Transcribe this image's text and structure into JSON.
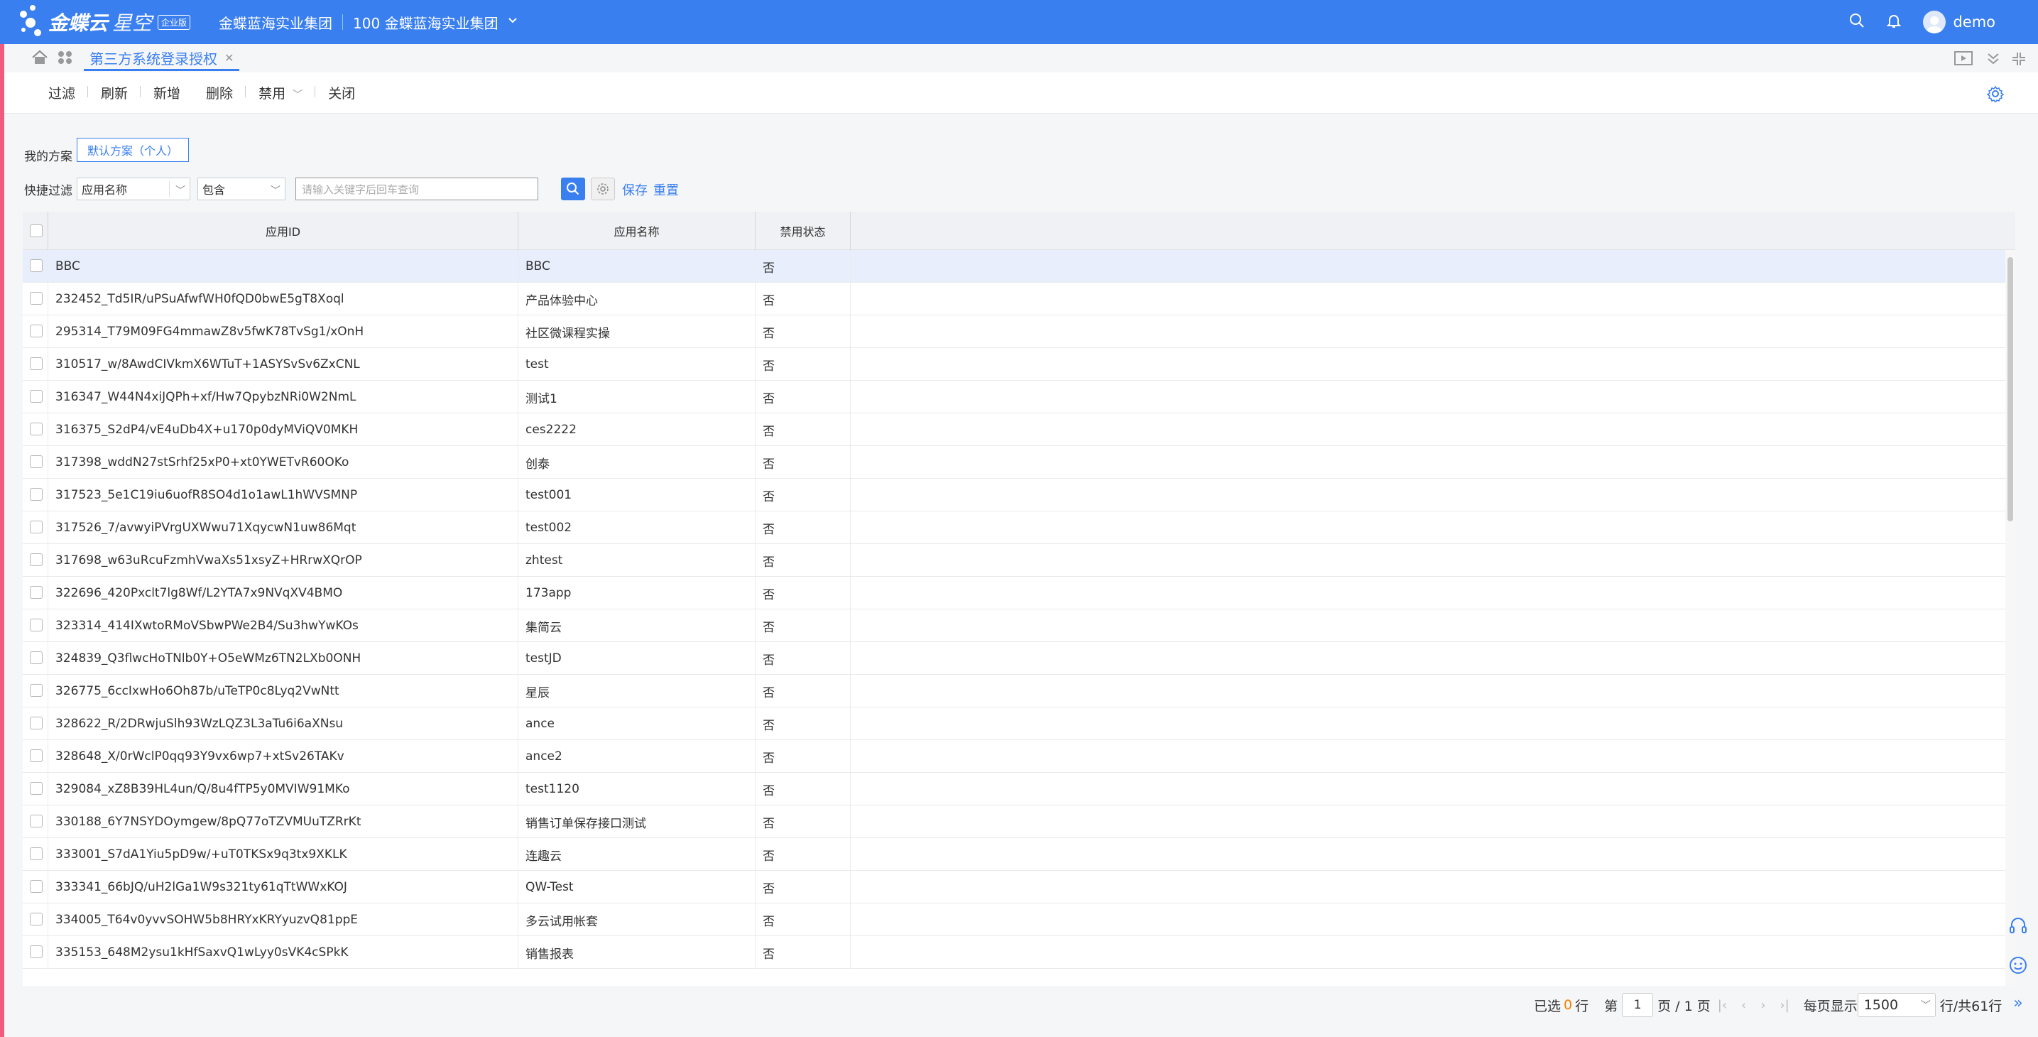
{
  "app": {
    "brand": "金蝶云",
    "product": "星空",
    "edition": "企业版",
    "org_name": "金蝶蓝海实业集团",
    "org_code_name": "100 金蝶蓝海实业集团",
    "user": "demo"
  },
  "tabs": [
    {
      "label": "第三方系统登录授权",
      "active": true
    }
  ],
  "toolbar": {
    "filter": "过滤",
    "refresh": "刷新",
    "add": "新增",
    "delete": "删除",
    "disable": "禁用",
    "close": "关闭"
  },
  "scheme": {
    "label": "我的方案",
    "default": "默认方案（个人）"
  },
  "quick_filter": {
    "label": "快捷过滤",
    "field": "应用名称",
    "operator": "包含",
    "placeholder": "请输入关键字后回车查询",
    "save": "保存",
    "reset": "重置"
  },
  "table": {
    "columns": [
      "应用ID",
      "应用名称",
      "禁用状态"
    ],
    "rows": [
      [
        "BBC",
        "BBC",
        "否"
      ],
      [
        "232452_Td5IR/uPSuAfwfWH0fQD0bwE5gT8Xoql",
        "产品体验中心",
        "否"
      ],
      [
        "295314_T79M09FG4mmawZ8v5fwK78TvSg1/xOnH",
        "社区微课程实操",
        "否"
      ],
      [
        "310517_w/8AwdCIVkmX6WTuT+1ASYSvSv6ZxCNL",
        "test",
        "否"
      ],
      [
        "316347_W44N4xiJQPh+xf/Hw7QpybzNRi0W2NmL",
        "测试1",
        "否"
      ],
      [
        "316375_S2dP4/vE4uDb4X+u170p0dyMViQV0MKH",
        "ces2222",
        "否"
      ],
      [
        "317398_wddN27stSrhf25xP0+xt0YWETvR60OKo",
        "创泰",
        "否"
      ],
      [
        "317523_5e1C19iu6uofR8SO4d1o1awL1hWVSMNP",
        "test001",
        "否"
      ],
      [
        "317526_7/avwyiPVrgUXWwu71XqycwN1uw86Mqt",
        "test002",
        "否"
      ],
      [
        "317698_w63uRcuFzmhVwaXs51xsyZ+HRrwXQrOP",
        "zhtest",
        "否"
      ],
      [
        "322696_420Pxclt7lg8Wf/L2YTA7x9NVqXV4BMO",
        "173app",
        "否"
      ],
      [
        "323314_414IXwtoRMoVSbwPWe2B4/Su3hwYwKOs",
        "集简云",
        "否"
      ],
      [
        "324839_Q3flwcHoTNlb0Y+O5eWMz6TN2LXb0ONH",
        "testJD",
        "否"
      ],
      [
        "326775_6ccIxwHo6Oh87b/uTeTP0c8Lyq2VwNtt",
        "星辰",
        "否"
      ],
      [
        "328622_R/2DRwjuSlh93WzLQZ3L3aTu6i6aXNsu",
        "ance",
        "否"
      ],
      [
        "328648_X/0rWclP0qq93Y9vx6wp7+xtSv26TAKv",
        "ance2",
        "否"
      ],
      [
        "329084_xZ8B39HL4un/Q/8u4fTP5y0MVIW91MKo",
        "test1120",
        "否"
      ],
      [
        "330188_6Y7NSYDOymgew/8pQ77oTZVMUuTZRrKt",
        "销售订单保存接口测试",
        "否"
      ],
      [
        "333001_S7dA1Yiu5pD9w/+uT0TKSx9q3tx9XKLK",
        "连趣云",
        "否"
      ],
      [
        "333341_66bJQ/uH2lGa1W9s321ty61qTtWWxKOJ",
        "QW-Test",
        "否"
      ],
      [
        "334005_T64v0yvvSOHW5b8HRYxKRYyuzvQ81ppE",
        "多云试用帐套",
        "否"
      ],
      [
        "335153_648M2ysu1kHfSaxvQ1wLyy0sVK4cSPkK",
        "销售报表",
        "否"
      ]
    ]
  },
  "pager": {
    "selected_prefix": "已选",
    "selected_count": "0",
    "selected_suffix": "行",
    "page_prefix": "第",
    "page": "1",
    "page_suffix": "页 / 1 页",
    "per_page_label": "每页显示",
    "per_page": "1500",
    "total": "行/共61行"
  },
  "colors": {
    "primary": "#3a7ff0",
    "accent_edge": "#f05a7e",
    "selected_count": "#f08300"
  }
}
